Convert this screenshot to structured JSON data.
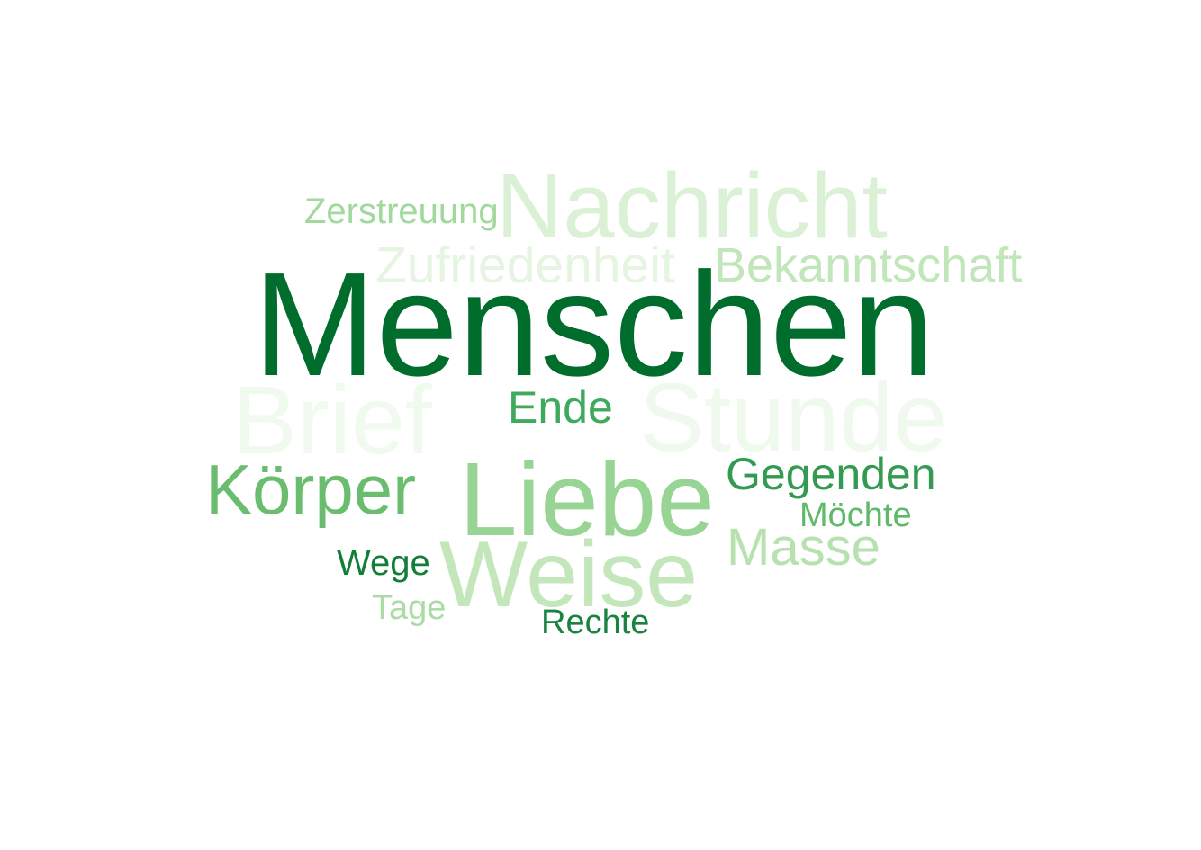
{
  "words": [
    {
      "key": "brief",
      "text": "Brief",
      "color": "#f1faee"
    },
    {
      "key": "stunde",
      "text": "Stunde",
      "color": "#f0f9ed"
    },
    {
      "key": "nachricht",
      "text": "Nachricht",
      "color": "#dbf1d6"
    },
    {
      "key": "zufrieden",
      "text": "Zufriedenheit",
      "color": "#e6f5e1"
    },
    {
      "key": "bekannt",
      "text": "Bekanntschaft",
      "color": "#c0e6b9"
    },
    {
      "key": "zerstreuung",
      "text": "Zerstreuung",
      "color": "#a0d99b"
    },
    {
      "key": "menschen",
      "text": "Menschen",
      "color": "#006d2c"
    },
    {
      "key": "ende",
      "text": "Ende",
      "color": "#3fa95c"
    },
    {
      "key": "koerper",
      "text": "Körper",
      "color": "#6abd6e"
    },
    {
      "key": "liebe",
      "text": "Liebe",
      "color": "#98d493"
    },
    {
      "key": "gegenden",
      "text": "Gegenden",
      "color": "#329b51"
    },
    {
      "key": "moechte",
      "text": "Möchte",
      "color": "#60b86a"
    },
    {
      "key": "masse",
      "text": "Masse",
      "color": "#b7e2b0"
    },
    {
      "key": "weise",
      "text": "Weise",
      "color": "#c3e7bb"
    },
    {
      "key": "wege",
      "text": "Wege",
      "color": "#137e3a"
    },
    {
      "key": "tage",
      "text": "Tage",
      "color": "#acdca5"
    },
    {
      "key": "rechte",
      "text": "Rechte",
      "color": "#1b8340"
    }
  ]
}
